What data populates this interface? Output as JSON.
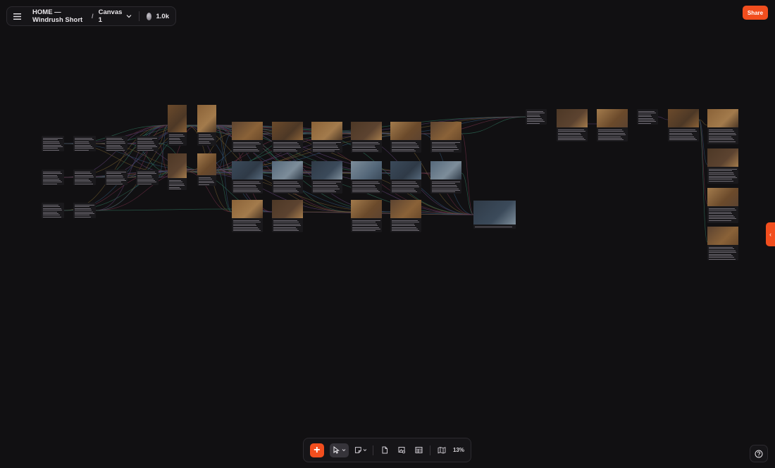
{
  "header": {
    "menu_icon": "hamburger-menu-icon",
    "project_title": "HOME — Windrush Short",
    "separator": "/",
    "canvas_name": "Canvas 1",
    "credits": "1.0k"
  },
  "share_label": "Share",
  "side_panel": {
    "toggle_icon": "chevron-left-icon"
  },
  "toolbar": {
    "add_icon": "plus-icon",
    "select_icon": "cursor-arrow-icon",
    "note_icon": "sticky-note-icon",
    "document_icon": "document-icon",
    "image_icon": "image-search-icon",
    "table_icon": "table-icon",
    "map_icon": "map-icon",
    "zoom": "13%"
  },
  "help_icon": "question-circle-icon",
  "colors": {
    "background": "#111012",
    "accent": "#f24e1e",
    "panel": "#161518",
    "node": "#1a191c"
  }
}
